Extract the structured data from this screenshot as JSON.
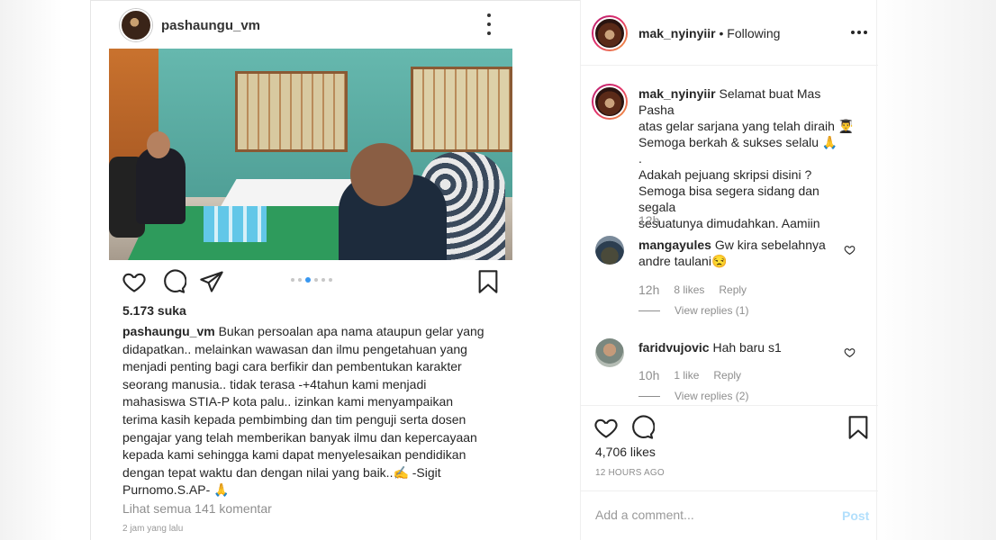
{
  "post_screenshot": {
    "username": "pashaungu_vm",
    "likes": "5.173 suka",
    "caption_user": "pashaungu_vm",
    "caption_text": " Bukan persoalan apa nama ataupun gelar yang\ndidapatkan.. melainkan wawasan dan ilmu pengetahuan yang\nmenjadi penting bagi cara berfikir dan pembentukan karakter\nseorang manusia.. tidak terasa -+4tahun kami menjadi\nmahasiswa STIA-P kota palu.. izinkan kami menyampaikan\nterima kasih kepada pembimbing dan tim penguji serta dosen\npengajar yang telah memberikan banyak ilmu dan kepercayaan\nkepada kami sehingga kami dapat menyelesaikan pendidikan\ndengan tepat waktu dan dengan nilai yang baik..✍ -Sigit\nPurnomo.S.AP- 🙏",
    "view_all": "Lihat semua 141 komentar",
    "posted_ago": "2 jam yang lalu",
    "carousel_active_index": 2,
    "carousel_count": 6
  },
  "panel": {
    "header_username": "mak_nyinyiir",
    "header_follow": " • Following",
    "main_comment_user": "mak_nyinyiir",
    "main_comment_text": " Selamat buat Mas Pasha\natas gelar sarjana yang telah diraih 👨‍🎓\nSemoga berkah & sukses selalu 🙏\n.\nAdakah pejuang skripsi disini ?\nSemoga bisa segera sidang dan segala\nsesuatunya dimudahkan. Aamiin",
    "main_comment_time": "12h",
    "comments": [
      {
        "user": "mangayules",
        "text": " Gw kira sebelahnya andre taulani😒",
        "time": "12h",
        "likes": "8 likes",
        "reply": "Reply",
        "view_replies": "View replies (1)"
      },
      {
        "user": "faridvujovic",
        "text": " Hah baru s1",
        "time": "10h",
        "likes": "1 like",
        "reply": "Reply",
        "view_replies": "View replies (2)"
      }
    ],
    "likes_count": "4,706 likes",
    "time_label": "12 HOURS AGO",
    "add_comment_placeholder": "Add a comment...",
    "post_button": "Post"
  }
}
